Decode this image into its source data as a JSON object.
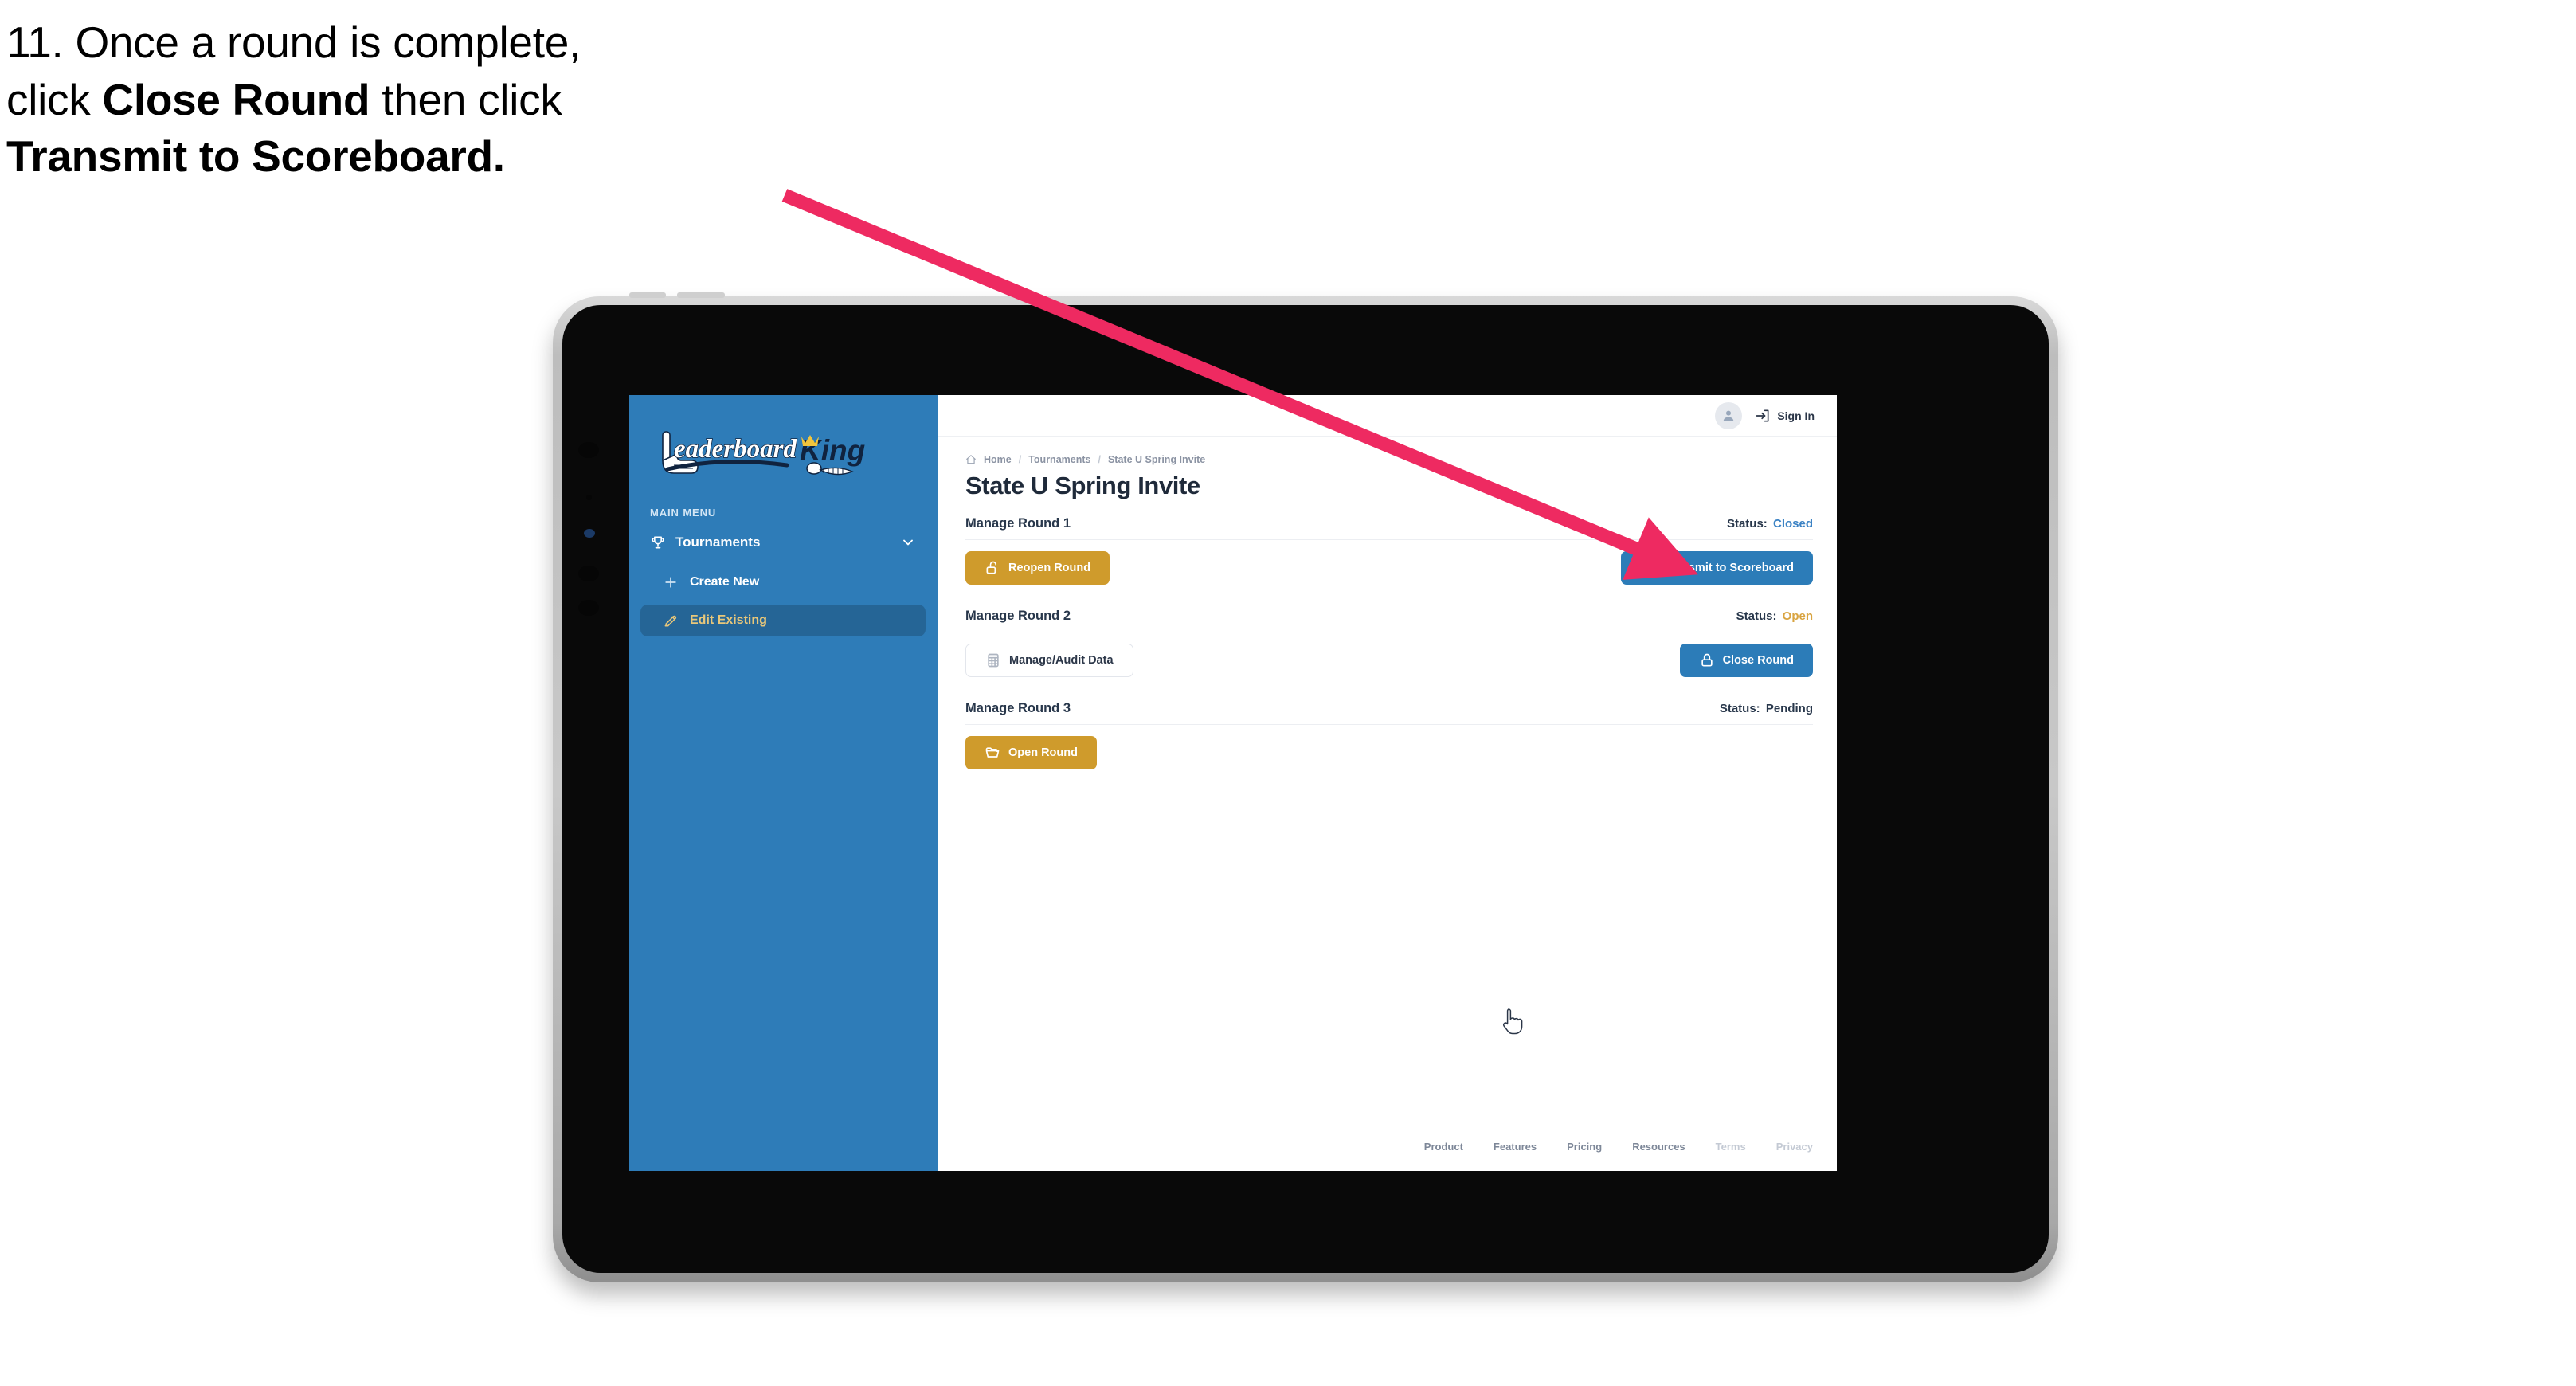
{
  "caption": {
    "line1_plain": "11. Once a round is complete,",
    "line2_pre": "click ",
    "line2_bold": "Close Round",
    "line2_post": " then click",
    "line3_bold": "Transmit to Scoreboard."
  },
  "sidebar": {
    "logo_text": "LeaderboardKing",
    "logo_word1": "Leaderboard",
    "logo_word2": "King",
    "menu_label": "MAIN MENU",
    "nav": {
      "tournaments": "Tournaments",
      "create_new": "Create New",
      "edit_existing": "Edit Existing"
    }
  },
  "topbar": {
    "sign_in": "Sign In"
  },
  "breadcrumb": {
    "home": "Home",
    "sep": "/",
    "tournaments": "Tournaments",
    "current": "State U Spring Invite"
  },
  "page": {
    "title": "State U Spring Invite"
  },
  "rounds": [
    {
      "title": "Manage Round 1",
      "status_label": "Status:",
      "status_value": "Closed",
      "status_class": "closed",
      "left_button": "Reopen Round",
      "left_icon": "unlock-icon",
      "right_button": "Transmit to Scoreboard",
      "right_icon": "send-icon"
    },
    {
      "title": "Manage Round 2",
      "status_label": "Status:",
      "status_value": "Open",
      "status_class": "open",
      "left_button": "Manage/Audit Data",
      "left_icon": "table-icon",
      "right_button": "Close Round",
      "right_icon": "lock-icon"
    },
    {
      "title": "Manage Round 3",
      "status_label": "Status:",
      "status_value": "Pending",
      "status_class": "pending",
      "left_button": "Open Round",
      "left_icon": "folder-open-icon",
      "right_button": "",
      "right_icon": ""
    }
  ],
  "footer": {
    "links": [
      "Product",
      "Features",
      "Pricing",
      "Resources",
      "Terms",
      "Privacy"
    ]
  },
  "colors": {
    "sidebar_blue": "#2E7CB8",
    "button_blue": "#2C7CB8",
    "button_gold": "#CF9B2C",
    "status_open": "#D9A441",
    "status_closed": "#3B82C4",
    "accent_gold_text": "#E8C77A",
    "arrow_pink": "#EE2A61"
  }
}
